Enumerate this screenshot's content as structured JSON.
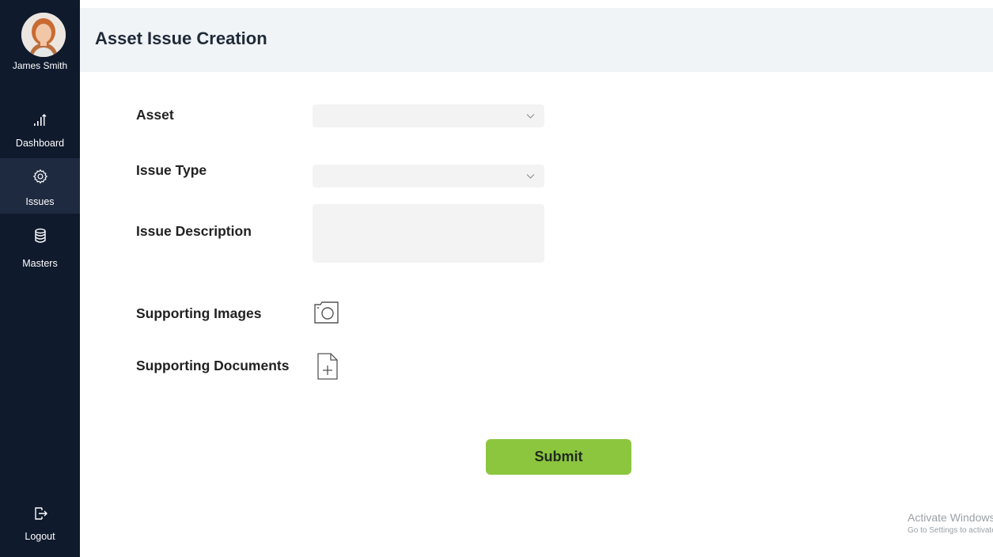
{
  "sidebar": {
    "user_name": "James Smith",
    "items": [
      {
        "label": "Dashboard",
        "icon": "bar-chart-up-icon"
      },
      {
        "label": "Issues",
        "icon": "gear-icon",
        "active": true
      },
      {
        "label": "Masters",
        "icon": "database-icon"
      }
    ],
    "logout": {
      "label": "Logout",
      "icon": "logout-icon"
    }
  },
  "header": {
    "title": "Asset Issue Creation"
  },
  "form": {
    "asset": {
      "label": "Asset",
      "value": ""
    },
    "issue_type": {
      "label": "Issue Type",
      "value": ""
    },
    "issue_description": {
      "label": "Issue Description",
      "value": ""
    },
    "supporting_images": {
      "label": "Supporting Images",
      "icon": "camera-icon"
    },
    "supporting_documents": {
      "label": "Supporting Documents",
      "icon": "add-document-icon"
    },
    "submit_label": "Submit"
  },
  "watermark": {
    "line1": "Activate Windows",
    "line2": "Go to Settings to activate Windows."
  },
  "colors": {
    "sidebar_bg": "#0f1a2d",
    "header_bg": "#f1f4f7",
    "submit_bg": "#8cc63f"
  }
}
